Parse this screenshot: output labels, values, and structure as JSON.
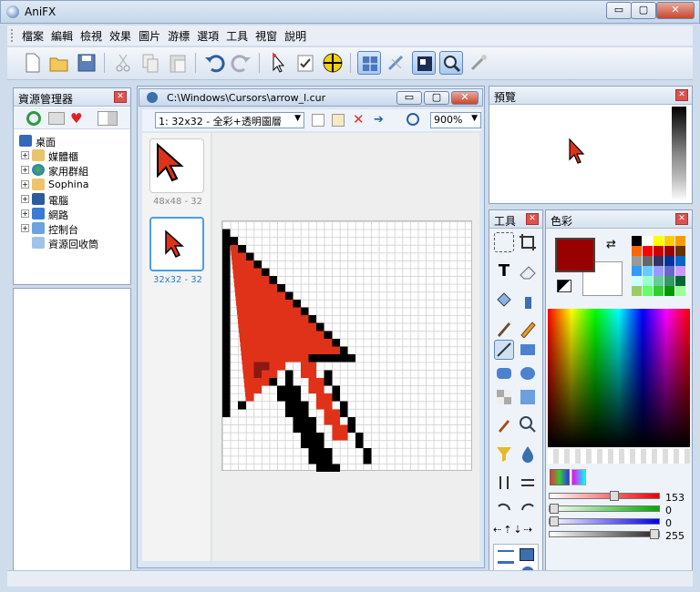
{
  "app": {
    "title": "AniFX"
  },
  "window_buttons": {
    "minimize": "▭",
    "maximize": "▢",
    "close": "✕"
  },
  "menu": [
    "檔案",
    "編輯",
    "檢視",
    "效果",
    "圖片",
    "游標",
    "選項",
    "工具",
    "視窗",
    "說明"
  ],
  "toolbar_icons": [
    "new-file-icon",
    "open-folder-icon",
    "save-icon",
    "cut-icon",
    "copy-icon",
    "paste-icon",
    "undo-icon",
    "redo-icon",
    "cursor-select-icon",
    "checklist-icon",
    "hotspot-icon",
    "grid-toggle-icon",
    "erase-bg-icon",
    "preview-icon",
    "zoom-icon",
    "magic-wand-icon"
  ],
  "explorer": {
    "title": "資源管理器",
    "close": "✕",
    "items": [
      {
        "label": "桌面",
        "icon": "desktop-icon",
        "expandable": false
      },
      {
        "label": "媒體櫃",
        "icon": "library-icon",
        "expandable": true
      },
      {
        "label": "家用群組",
        "icon": "homegroup-icon",
        "expandable": true
      },
      {
        "label": "Sophina",
        "icon": "user-folder-icon",
        "expandable": true
      },
      {
        "label": "電腦",
        "icon": "computer-icon",
        "expandable": true
      },
      {
        "label": "網路",
        "icon": "network-icon",
        "expandable": true
      },
      {
        "label": "控制台",
        "icon": "control-panel-icon",
        "expandable": true
      },
      {
        "label": "資源回收筒",
        "icon": "recycle-bin-icon",
        "expandable": false
      }
    ]
  },
  "document": {
    "path": "C:\\Windows\\Cursors\\arrow_l.cur",
    "frame_select": "1: 32x32 - 全彩+透明圖層",
    "zoom_select": "900%",
    "thumbs": [
      {
        "label": "48x48 - 32",
        "selected": false
      },
      {
        "label": "32x32 - 32",
        "selected": true
      }
    ]
  },
  "preview": {
    "title": "預覽",
    "close": "✕"
  },
  "tools": {
    "title": "工具",
    "close": "✕"
  },
  "colors": {
    "title": "色彩",
    "close": "✕",
    "foreground": "#990000",
    "background": "#ffffff",
    "red": {
      "value": "153",
      "fraction": 0.6
    },
    "green": {
      "value": "0",
      "fraction": 0.0
    },
    "blue": {
      "value": "0",
      "fraction": 0.0
    },
    "alpha": {
      "value": "255",
      "fraction": 1.0
    },
    "palette": [
      "#000000",
      "#ffffff",
      "#ffff00",
      "#ffcc00",
      "#ff9900",
      "#ff6600",
      "#ff0000",
      "#cc0000",
      "#990000",
      "#663300",
      "#999999",
      "#666666",
      "#333366",
      "#003399",
      "#0066cc",
      "#3399ff",
      "#66ccff",
      "#9999ff",
      "#6666cc",
      "#cc99ff",
      "#ccffff",
      "#99ffcc",
      "#66cc99",
      "#339966",
      "#006633",
      "#99cc66",
      "#66ff66",
      "#33cc33",
      "#009900",
      "#99ff99"
    ]
  }
}
